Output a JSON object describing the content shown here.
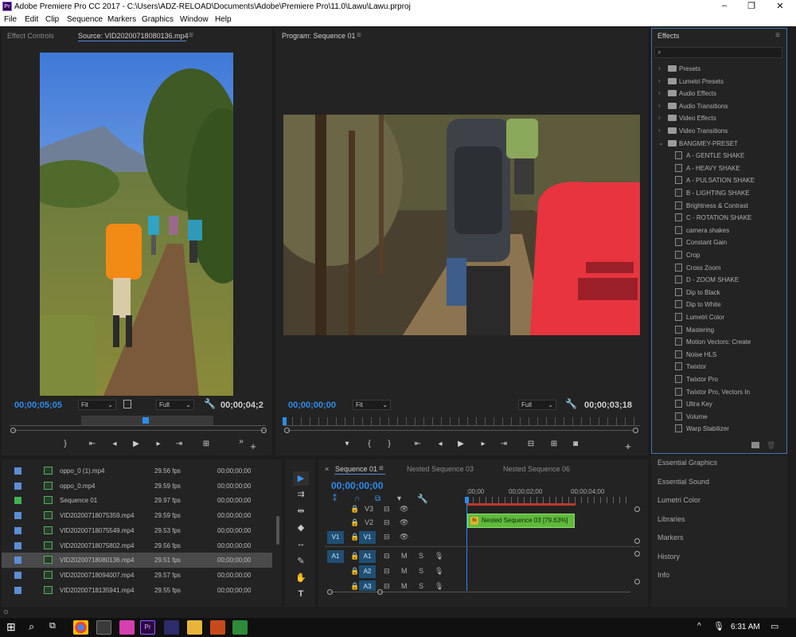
{
  "window": {
    "title": "Adobe Premiere Pro CC 2017 - C:\\Users\\ADZ-RELOAD\\Documents\\Adobe\\Premiere Pro\\11.0\\Lawu\\Lawu.prproj",
    "logo": "Pr",
    "minimize": "–",
    "maximize": "❐",
    "close": "✕"
  },
  "menu": [
    "File",
    "Edit",
    "Clip",
    "Sequence",
    "Markers",
    "Graphics",
    "Window",
    "Help"
  ],
  "source": {
    "tab_effect_controls": "Effect Controls",
    "tab_source": "Source: VID20200718080136.mp4",
    "timecode": "00;00;05;05",
    "fit": "Fit",
    "quality": "Full",
    "duration": "00;00;04;2"
  },
  "program": {
    "tab": "Program: Sequence 01",
    "timecode": "00;00;00;00",
    "fit": "Fit",
    "quality": "Full",
    "duration": "00;00;03;18"
  },
  "effects": {
    "tab": "Effects",
    "items": [
      {
        "label": "Presets",
        "kind": "folder"
      },
      {
        "label": "Lumetri Presets",
        "kind": "folder"
      },
      {
        "label": "Audio Effects",
        "kind": "folder"
      },
      {
        "label": "Audio Transitions",
        "kind": "folder"
      },
      {
        "label": "Video Effects",
        "kind": "folder"
      },
      {
        "label": "Video Transitions",
        "kind": "folder"
      },
      {
        "label": "BANGMEY-PRESET",
        "kind": "folder-open"
      },
      {
        "label": "A - GENTLE SHAKE",
        "kind": "fx"
      },
      {
        "label": "A - HEAVY SHAKE",
        "kind": "fx"
      },
      {
        "label": "A - PULSATION SHAKE",
        "kind": "fx"
      },
      {
        "label": "B - LIGHTING SHAKE",
        "kind": "fx"
      },
      {
        "label": "Brightness & Contrast",
        "kind": "fx"
      },
      {
        "label": "C - ROTATION SHAKE",
        "kind": "fx"
      },
      {
        "label": "camera shakes",
        "kind": "fx"
      },
      {
        "label": "Constant Gain",
        "kind": "fx"
      },
      {
        "label": "Crop",
        "kind": "fx"
      },
      {
        "label": "Cross Zoom",
        "kind": "fx"
      },
      {
        "label": "D - ZOOM SHAKE",
        "kind": "fx"
      },
      {
        "label": "Dip to Black",
        "kind": "fx"
      },
      {
        "label": "Dip to White",
        "kind": "fx"
      },
      {
        "label": "Lumetri Color",
        "kind": "fx"
      },
      {
        "label": "Mastering",
        "kind": "fx"
      },
      {
        "label": "Motion Vectors: Create",
        "kind": "fx"
      },
      {
        "label": "Noise HLS",
        "kind": "fx"
      },
      {
        "label": "Twixtor",
        "kind": "fx"
      },
      {
        "label": "Twixtor Pro",
        "kind": "fx"
      },
      {
        "label": "Twixtor Pro, Vectors In",
        "kind": "fx"
      },
      {
        "label": "Ultra Key",
        "kind": "fx"
      },
      {
        "label": "Volume",
        "kind": "fx"
      },
      {
        "label": "Warp Stabilizer",
        "kind": "fx"
      }
    ]
  },
  "right_panels": [
    "Essential Graphics",
    "Essential Sound",
    "Lumetri Color",
    "Libraries",
    "Markers",
    "History",
    "Info"
  ],
  "project": {
    "rows": [
      {
        "name": "oppo_0 (1).mp4",
        "fps": "29.56 fps",
        "start": "00;00;00;00",
        "color": "#5a8fd6",
        "selected": false
      },
      {
        "name": "oppo_0.mp4",
        "fps": "29.59 fps",
        "start": "00;00;00;00",
        "color": "#5a8fd6",
        "selected": false
      },
      {
        "name": "Sequence 01",
        "fps": "29.97 fps",
        "start": "00;00;00;00",
        "color": "#3fb34f",
        "selected": false
      },
      {
        "name": "VID20200718075359.mp4",
        "fps": "29.59 fps",
        "start": "00;00;00;00",
        "color": "#5a8fd6",
        "selected": false
      },
      {
        "name": "VID20200718075549.mp4",
        "fps": "29.53 fps",
        "start": "00;00;00;00",
        "color": "#5a8fd6",
        "selected": false
      },
      {
        "name": "VID20200718075802.mp4",
        "fps": "29.56 fps",
        "start": "00;00;00;00",
        "color": "#5a8fd6",
        "selected": false
      },
      {
        "name": "VID20200718080136.mp4",
        "fps": "29.51 fps",
        "start": "00;00;00;00",
        "color": "#5a8fd6",
        "selected": true
      },
      {
        "name": "VID20200718094007.mp4",
        "fps": "29.57 fps",
        "start": "00;00;00;00",
        "color": "#5a8fd6",
        "selected": false
      },
      {
        "name": "VID20200718135941.mp4",
        "fps": "29.55 fps",
        "start": "00;00;00;00",
        "color": "#5a8fd6",
        "selected": false
      }
    ]
  },
  "timeline": {
    "tabs": [
      "Sequence 01",
      "Nested Sequence 03",
      "Nested Sequence 06"
    ],
    "close": "×",
    "timecode": "00;00;00;00",
    "ruler": [
      ";00;00",
      "00;00;02;00",
      "00;00;04;00"
    ],
    "video_tracks": [
      "V3",
      "V2",
      "V1"
    ],
    "audio_tracks": [
      "A1",
      "A2",
      "A3"
    ],
    "source_v": "V1",
    "source_a": "A1",
    "clip_label": "Nested Sequence 03 [79.63%]",
    "clip_fx": "fx",
    "m": "M",
    "s": "S"
  },
  "taskbar": {
    "time": "6:31 AM"
  },
  "colors": {
    "accent": "#2d8ceb",
    "clip": "#5fba3c",
    "selected_row": "#4a4a4a"
  }
}
